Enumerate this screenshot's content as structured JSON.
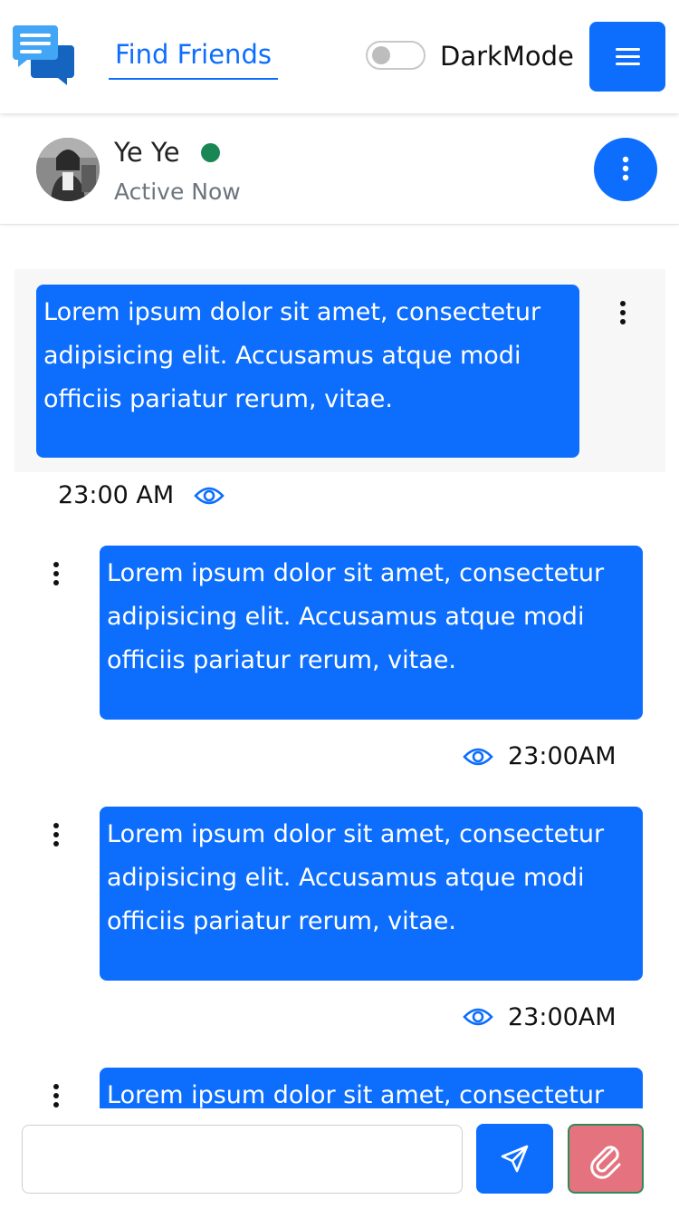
{
  "navbar": {
    "logo_icon": "chat-bubbles-icon",
    "find_friends_label": "Find Friends",
    "dark_mode_label": "DarkMode",
    "dark_mode_enabled": false,
    "menu_icon": "hamburger-icon"
  },
  "chat_header": {
    "user_name": "Ye Ye",
    "status_text": "Active Now",
    "online": true,
    "options_icon": "vertical-dots-icon"
  },
  "messages": [
    {
      "direction": "received",
      "text": "Lorem ipsum dolor sit amet, consectetur adipisicing elit. Accusamus atque modi officiis pariatur rerum, vitae.",
      "time": "23:00 AM",
      "seen_icon": "eye-icon"
    },
    {
      "direction": "sent",
      "text": "Lorem ipsum dolor sit amet, consectetur adipisicing elit. Accusamus atque modi officiis pariatur rerum, vitae.",
      "time": "23:00AM",
      "seen_icon": "eye-icon"
    },
    {
      "direction": "sent",
      "text": "Lorem ipsum dolor sit amet, consectetur adipisicing elit. Accusamus atque modi officiis pariatur rerum, vitae.",
      "time": "23:00AM",
      "seen_icon": "eye-icon"
    },
    {
      "direction": "sent",
      "text": "Lorem ipsum dolor sit amet, consectetur adipisicing elit. Accusamus atque modi officiis pariatur rerum, vitae.",
      "time": "",
      "seen_icon": "eye-icon"
    }
  ],
  "composer": {
    "input_value": "",
    "send_icon": "paper-plane-icon",
    "attach_icon": "paperclip-icon"
  },
  "colors": {
    "primary": "#0d6efd",
    "online": "#198754",
    "attach": "#e4737f",
    "attach_border": "#2e8b57"
  }
}
